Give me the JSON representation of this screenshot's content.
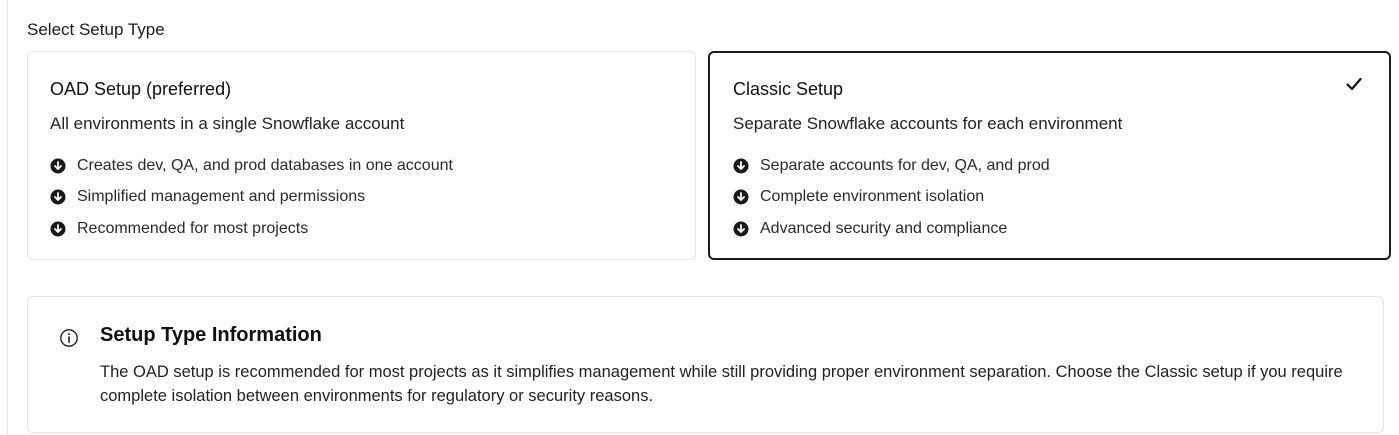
{
  "section_label": "Select Setup Type",
  "options": [
    {
      "title": "OAD Setup (preferred)",
      "description": "All environments in a single Snowflake account",
      "selected": false,
      "features": [
        "Creates dev, QA, and prod databases in one account",
        "Simplified management and permissions",
        "Recommended for most projects"
      ]
    },
    {
      "title": "Classic Setup",
      "description": "Separate Snowflake accounts for each environment",
      "selected": true,
      "features": [
        "Separate accounts for dev, QA, and prod",
        "Complete environment isolation",
        "Advanced security and compliance"
      ]
    }
  ],
  "info": {
    "title": "Setup Type Information",
    "text": "The OAD setup is recommended for most projects as it simplifies management while still providing proper environment separation. Choose the Classic setup if you require complete isolation between environments for regulatory or security reasons."
  },
  "icons": {
    "bullet": "arrow-down-circle-icon",
    "selected": "checkmark-icon",
    "info": "info-circle-icon"
  },
  "colors": {
    "selected_border": "#1c1c1c",
    "card_border": "#e3e3e3",
    "text": "#1f1f1f"
  }
}
